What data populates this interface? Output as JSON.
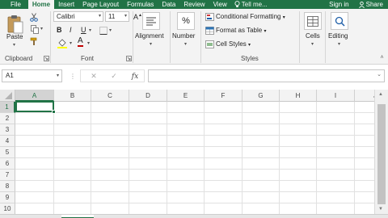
{
  "tabs": [
    "File",
    "Home",
    "Insert",
    "Page Layout",
    "Formulas",
    "Data",
    "Review",
    "View"
  ],
  "tell_me": "Tell me...",
  "sign_in": "Sign in",
  "share": "Share",
  "ribbon": {
    "clipboard": {
      "paste": "Paste",
      "label": "Clipboard"
    },
    "font": {
      "name": "Calibri",
      "size": "11",
      "bold": "B",
      "italic": "I",
      "underline": "U",
      "grow": "A",
      "shrink": "A",
      "color_a": "A",
      "label": "Font"
    },
    "alignment": {
      "label": "Alignment"
    },
    "number": {
      "label": "Number",
      "symbol": "%"
    },
    "styles": {
      "conditional": "Conditional Formatting",
      "format_table": "Format as Table",
      "cell_styles": "Cell Styles",
      "label": "Styles"
    },
    "cells": {
      "label": "Cells"
    },
    "editing": {
      "label": "Editing"
    }
  },
  "formula_bar": {
    "name_box": "A1",
    "cancel": "✕",
    "enter": "✓",
    "fx": "fx",
    "value": ""
  },
  "columns": [
    "A",
    "B",
    "C",
    "D",
    "E",
    "F",
    "G",
    "H",
    "I",
    "J"
  ],
  "rows": [
    "1",
    "2",
    "3",
    "4",
    "5",
    "6",
    "7",
    "8",
    "9",
    "10"
  ],
  "active_cell": "A1",
  "colors": {
    "accent": "#217346",
    "ribbon_bg": "#f3f3f3",
    "font_color": "#c00000",
    "highlight": "#ffff00"
  }
}
